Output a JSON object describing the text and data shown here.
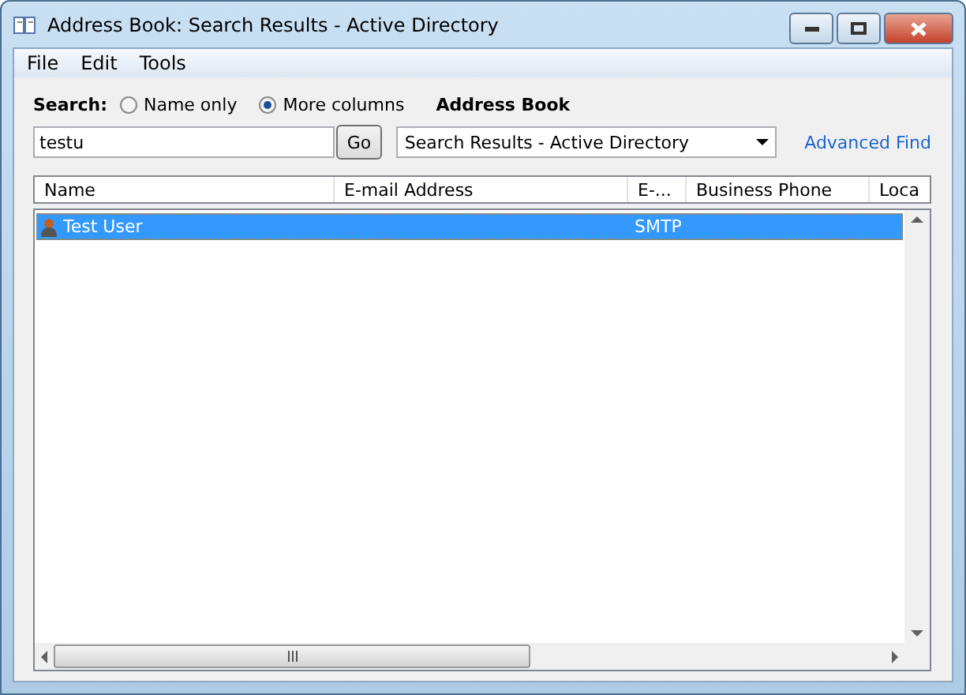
{
  "window": {
    "title": "Address Book: Search Results - Active Directory"
  },
  "menu": [
    "File",
    "Edit",
    "Tools"
  ],
  "search": {
    "label": "Search:",
    "options": [
      {
        "label": "Name only",
        "selected": false
      },
      {
        "label": "More columns",
        "selected": true
      }
    ],
    "value": "testu",
    "go": "Go"
  },
  "address_book": {
    "label": "Address Book",
    "value": "Search Results - Active Directory",
    "advanced_find": "Advanced Find"
  },
  "table": {
    "columns": [
      "Name",
      "E-mail Address",
      "E-...",
      "Business Phone",
      "Loca"
    ],
    "rows": [
      {
        "cells": [
          "Test User",
          "",
          "SMTP",
          "",
          ""
        ],
        "selected": true
      }
    ]
  }
}
